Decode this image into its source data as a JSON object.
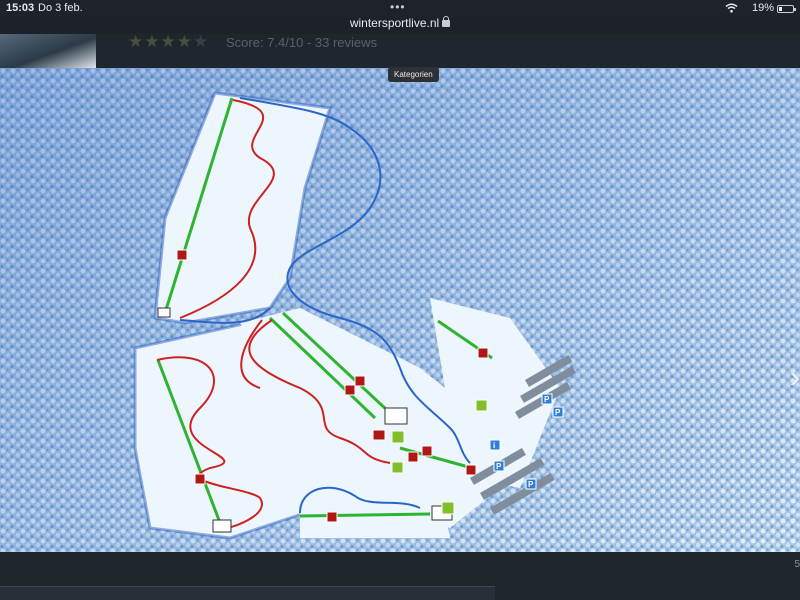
{
  "status_bar": {
    "time": "15:03",
    "date": "Do 3 feb.",
    "battery": "19%"
  },
  "browser": {
    "url": "wintersportlive.nl",
    "more_icon": "more-dots-icon"
  },
  "page": {
    "rating": {
      "stars_filled": 4,
      "stars_total": 5,
      "score_text": "Score: 7.4/10 - 33 reviews"
    },
    "map_button": "Kategorien",
    "bottom_side_text": "5"
  },
  "icons": [
    "wifi-icon",
    "battery-icon",
    "lock-icon",
    "star-icon",
    "parking-icon",
    "restaurant-icon",
    "lift-station-icon",
    "chevron-right-icon"
  ],
  "colors": {
    "lift": "#2fb432",
    "piste_red": "#cc2222",
    "piste_blue": "#2a66c8",
    "parking": "#2f7fd6",
    "snow": "#eaf3fb",
    "forest": "#8fb6d9"
  }
}
